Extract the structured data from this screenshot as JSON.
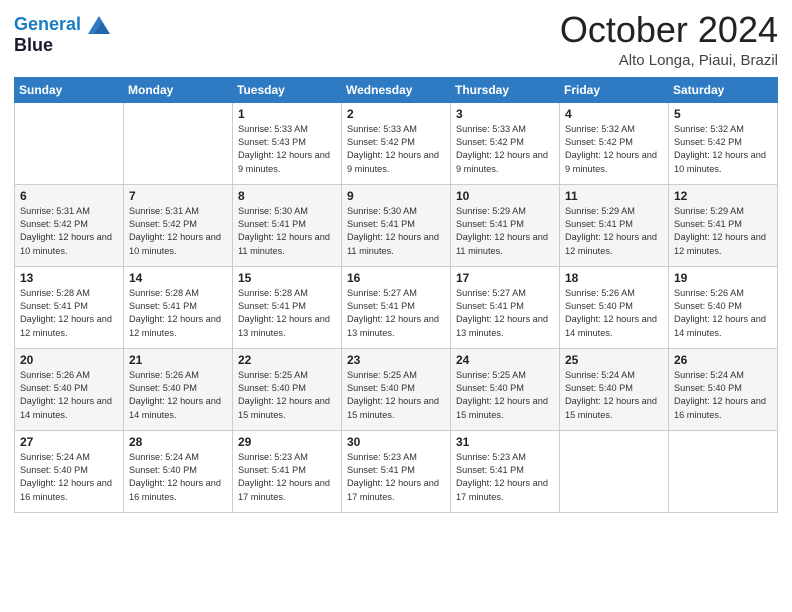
{
  "logo": {
    "line1": "General",
    "line2": "Blue"
  },
  "header": {
    "month": "October 2024",
    "location": "Alto Longa, Piaui, Brazil"
  },
  "weekdays": [
    "Sunday",
    "Monday",
    "Tuesday",
    "Wednesday",
    "Thursday",
    "Friday",
    "Saturday"
  ],
  "weeks": [
    [
      {
        "day": "",
        "sunrise": "",
        "sunset": "",
        "daylight": ""
      },
      {
        "day": "",
        "sunrise": "",
        "sunset": "",
        "daylight": ""
      },
      {
        "day": "1",
        "sunrise": "Sunrise: 5:33 AM",
        "sunset": "Sunset: 5:43 PM",
        "daylight": "Daylight: 12 hours and 9 minutes."
      },
      {
        "day": "2",
        "sunrise": "Sunrise: 5:33 AM",
        "sunset": "Sunset: 5:42 PM",
        "daylight": "Daylight: 12 hours and 9 minutes."
      },
      {
        "day": "3",
        "sunrise": "Sunrise: 5:33 AM",
        "sunset": "Sunset: 5:42 PM",
        "daylight": "Daylight: 12 hours and 9 minutes."
      },
      {
        "day": "4",
        "sunrise": "Sunrise: 5:32 AM",
        "sunset": "Sunset: 5:42 PM",
        "daylight": "Daylight: 12 hours and 9 minutes."
      },
      {
        "day": "5",
        "sunrise": "Sunrise: 5:32 AM",
        "sunset": "Sunset: 5:42 PM",
        "daylight": "Daylight: 12 hours and 10 minutes."
      }
    ],
    [
      {
        "day": "6",
        "sunrise": "Sunrise: 5:31 AM",
        "sunset": "Sunset: 5:42 PM",
        "daylight": "Daylight: 12 hours and 10 minutes."
      },
      {
        "day": "7",
        "sunrise": "Sunrise: 5:31 AM",
        "sunset": "Sunset: 5:42 PM",
        "daylight": "Daylight: 12 hours and 10 minutes."
      },
      {
        "day": "8",
        "sunrise": "Sunrise: 5:30 AM",
        "sunset": "Sunset: 5:41 PM",
        "daylight": "Daylight: 12 hours and 11 minutes."
      },
      {
        "day": "9",
        "sunrise": "Sunrise: 5:30 AM",
        "sunset": "Sunset: 5:41 PM",
        "daylight": "Daylight: 12 hours and 11 minutes."
      },
      {
        "day": "10",
        "sunrise": "Sunrise: 5:29 AM",
        "sunset": "Sunset: 5:41 PM",
        "daylight": "Daylight: 12 hours and 11 minutes."
      },
      {
        "day": "11",
        "sunrise": "Sunrise: 5:29 AM",
        "sunset": "Sunset: 5:41 PM",
        "daylight": "Daylight: 12 hours and 12 minutes."
      },
      {
        "day": "12",
        "sunrise": "Sunrise: 5:29 AM",
        "sunset": "Sunset: 5:41 PM",
        "daylight": "Daylight: 12 hours and 12 minutes."
      }
    ],
    [
      {
        "day": "13",
        "sunrise": "Sunrise: 5:28 AM",
        "sunset": "Sunset: 5:41 PM",
        "daylight": "Daylight: 12 hours and 12 minutes."
      },
      {
        "day": "14",
        "sunrise": "Sunrise: 5:28 AM",
        "sunset": "Sunset: 5:41 PM",
        "daylight": "Daylight: 12 hours and 12 minutes."
      },
      {
        "day": "15",
        "sunrise": "Sunrise: 5:28 AM",
        "sunset": "Sunset: 5:41 PM",
        "daylight": "Daylight: 12 hours and 13 minutes."
      },
      {
        "day": "16",
        "sunrise": "Sunrise: 5:27 AM",
        "sunset": "Sunset: 5:41 PM",
        "daylight": "Daylight: 12 hours and 13 minutes."
      },
      {
        "day": "17",
        "sunrise": "Sunrise: 5:27 AM",
        "sunset": "Sunset: 5:41 PM",
        "daylight": "Daylight: 12 hours and 13 minutes."
      },
      {
        "day": "18",
        "sunrise": "Sunrise: 5:26 AM",
        "sunset": "Sunset: 5:40 PM",
        "daylight": "Daylight: 12 hours and 14 minutes."
      },
      {
        "day": "19",
        "sunrise": "Sunrise: 5:26 AM",
        "sunset": "Sunset: 5:40 PM",
        "daylight": "Daylight: 12 hours and 14 minutes."
      }
    ],
    [
      {
        "day": "20",
        "sunrise": "Sunrise: 5:26 AM",
        "sunset": "Sunset: 5:40 PM",
        "daylight": "Daylight: 12 hours and 14 minutes."
      },
      {
        "day": "21",
        "sunrise": "Sunrise: 5:26 AM",
        "sunset": "Sunset: 5:40 PM",
        "daylight": "Daylight: 12 hours and 14 minutes."
      },
      {
        "day": "22",
        "sunrise": "Sunrise: 5:25 AM",
        "sunset": "Sunset: 5:40 PM",
        "daylight": "Daylight: 12 hours and 15 minutes."
      },
      {
        "day": "23",
        "sunrise": "Sunrise: 5:25 AM",
        "sunset": "Sunset: 5:40 PM",
        "daylight": "Daylight: 12 hours and 15 minutes."
      },
      {
        "day": "24",
        "sunrise": "Sunrise: 5:25 AM",
        "sunset": "Sunset: 5:40 PM",
        "daylight": "Daylight: 12 hours and 15 minutes."
      },
      {
        "day": "25",
        "sunrise": "Sunrise: 5:24 AM",
        "sunset": "Sunset: 5:40 PM",
        "daylight": "Daylight: 12 hours and 15 minutes."
      },
      {
        "day": "26",
        "sunrise": "Sunrise: 5:24 AM",
        "sunset": "Sunset: 5:40 PM",
        "daylight": "Daylight: 12 hours and 16 minutes."
      }
    ],
    [
      {
        "day": "27",
        "sunrise": "Sunrise: 5:24 AM",
        "sunset": "Sunset: 5:40 PM",
        "daylight": "Daylight: 12 hours and 16 minutes."
      },
      {
        "day": "28",
        "sunrise": "Sunrise: 5:24 AM",
        "sunset": "Sunset: 5:40 PM",
        "daylight": "Daylight: 12 hours and 16 minutes."
      },
      {
        "day": "29",
        "sunrise": "Sunrise: 5:23 AM",
        "sunset": "Sunset: 5:41 PM",
        "daylight": "Daylight: 12 hours and 17 minutes."
      },
      {
        "day": "30",
        "sunrise": "Sunrise: 5:23 AM",
        "sunset": "Sunset: 5:41 PM",
        "daylight": "Daylight: 12 hours and 17 minutes."
      },
      {
        "day": "31",
        "sunrise": "Sunrise: 5:23 AM",
        "sunset": "Sunset: 5:41 PM",
        "daylight": "Daylight: 12 hours and 17 minutes."
      },
      {
        "day": "",
        "sunrise": "",
        "sunset": "",
        "daylight": ""
      },
      {
        "day": "",
        "sunrise": "",
        "sunset": "",
        "daylight": ""
      }
    ]
  ]
}
